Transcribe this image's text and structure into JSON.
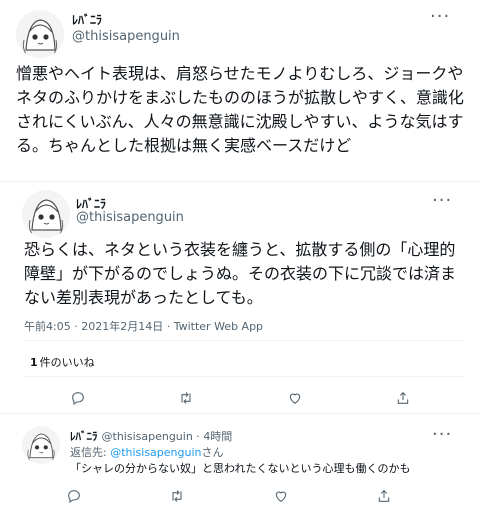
{
  "tweet1": {
    "name": "ﾚﾊﾞﾆﾗ",
    "handle": "@thisisapenguin",
    "text": "憎悪やヘイト表現は、肩怒らせたモノよりむしろ、ジョークやネタのふりかけをまぶしたもののほうが拡散しやすく、意識化されにくいぶん、人々の無意識に沈殿しやすい、ような気はする。ちゃんとした根拠は無く実感ベースだけど",
    "more": "···"
  },
  "tweet2": {
    "name": "ﾚﾊﾞﾆﾗ",
    "handle": "@thisisapenguin",
    "text": "恐らくは、ネタという衣装を纏うと、拡散する側の「心理的障壁」が下がるのでしょうぬ。その衣装の下に冗談では済まない差別表現があったとしても。",
    "time": "午前4:05",
    "date": "2021年2月14日",
    "source": "Twitter Web App",
    "sep": " · ",
    "likes_count": "1",
    "likes_label": "件のいいね",
    "more": "···"
  },
  "reply": {
    "name": "ﾚﾊﾞﾆﾗ",
    "handle": "@thisisapenguin",
    "time_sep": " · ",
    "time": "4時間",
    "reply_prefix": "返信先: ",
    "reply_to": "@thisisapenguin",
    "reply_suffix": "さん",
    "text": "「シャレの分からない奴」と思われたくないという心理も働くのかも",
    "more": "···"
  },
  "icons": [
    "reply-icon",
    "retweet-icon",
    "like-icon",
    "share-icon"
  ],
  "colors": {
    "link": "#1d9bf0",
    "secondary": "#536471",
    "divider": "#eff3f4"
  }
}
